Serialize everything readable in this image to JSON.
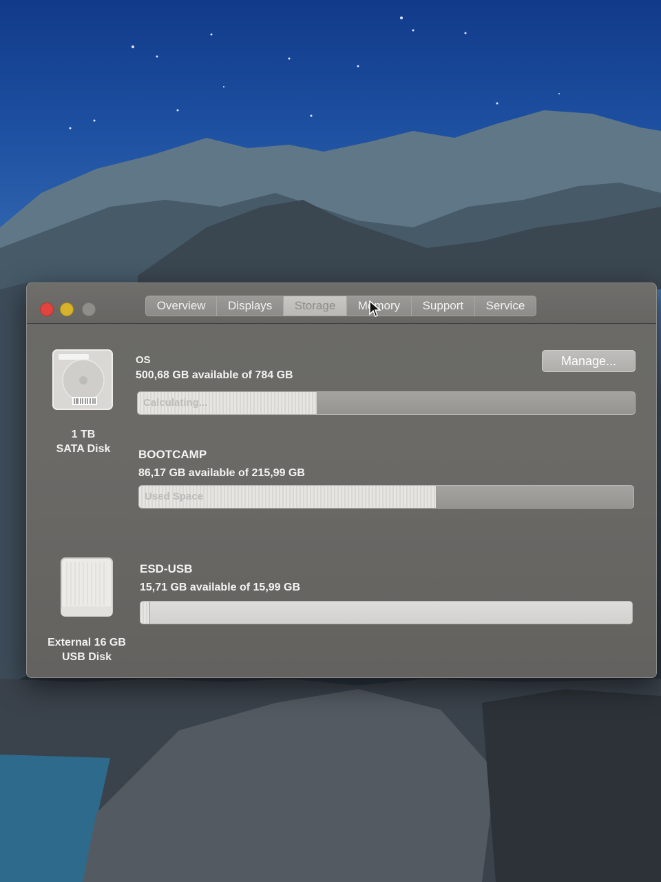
{
  "window": {
    "tabs": [
      {
        "label": "Overview"
      },
      {
        "label": "Displays"
      },
      {
        "label": "Storage"
      },
      {
        "label": "Memory"
      },
      {
        "label": "Support"
      },
      {
        "label": "Service"
      }
    ],
    "active_tab": "Storage"
  },
  "disks": [
    {
      "type_label_1": "1 TB",
      "type_label_2": "SATA Disk",
      "icon": "internal-hard-drive-icon",
      "volumes": [
        {
          "name": "OS",
          "availability": "500,68 GB available of 784 GB",
          "bar_text": "Calculating...",
          "used_fraction": 0.36
        },
        {
          "name": "BOOTCAMP",
          "availability": "86,17 GB available of 215,99 GB",
          "bar_text": "Used Space",
          "used_fraction": 0.6
        }
      ]
    },
    {
      "type_label_1": "External 16 GB",
      "type_label_2": "USB Disk",
      "icon": "external-usb-drive-icon",
      "volumes": [
        {
          "name": "ESD-USB",
          "availability": "15,71 GB available of 15,99 GB",
          "bar_text": "",
          "used_fraction": 0.018
        }
      ]
    }
  ],
  "manage_button": {
    "label": "Manage..."
  },
  "colors": {
    "close": "#e0443e",
    "minimize": "#d6b32a",
    "zoom_disabled": "#8f8e8b",
    "window_bg": "#6a6966"
  }
}
